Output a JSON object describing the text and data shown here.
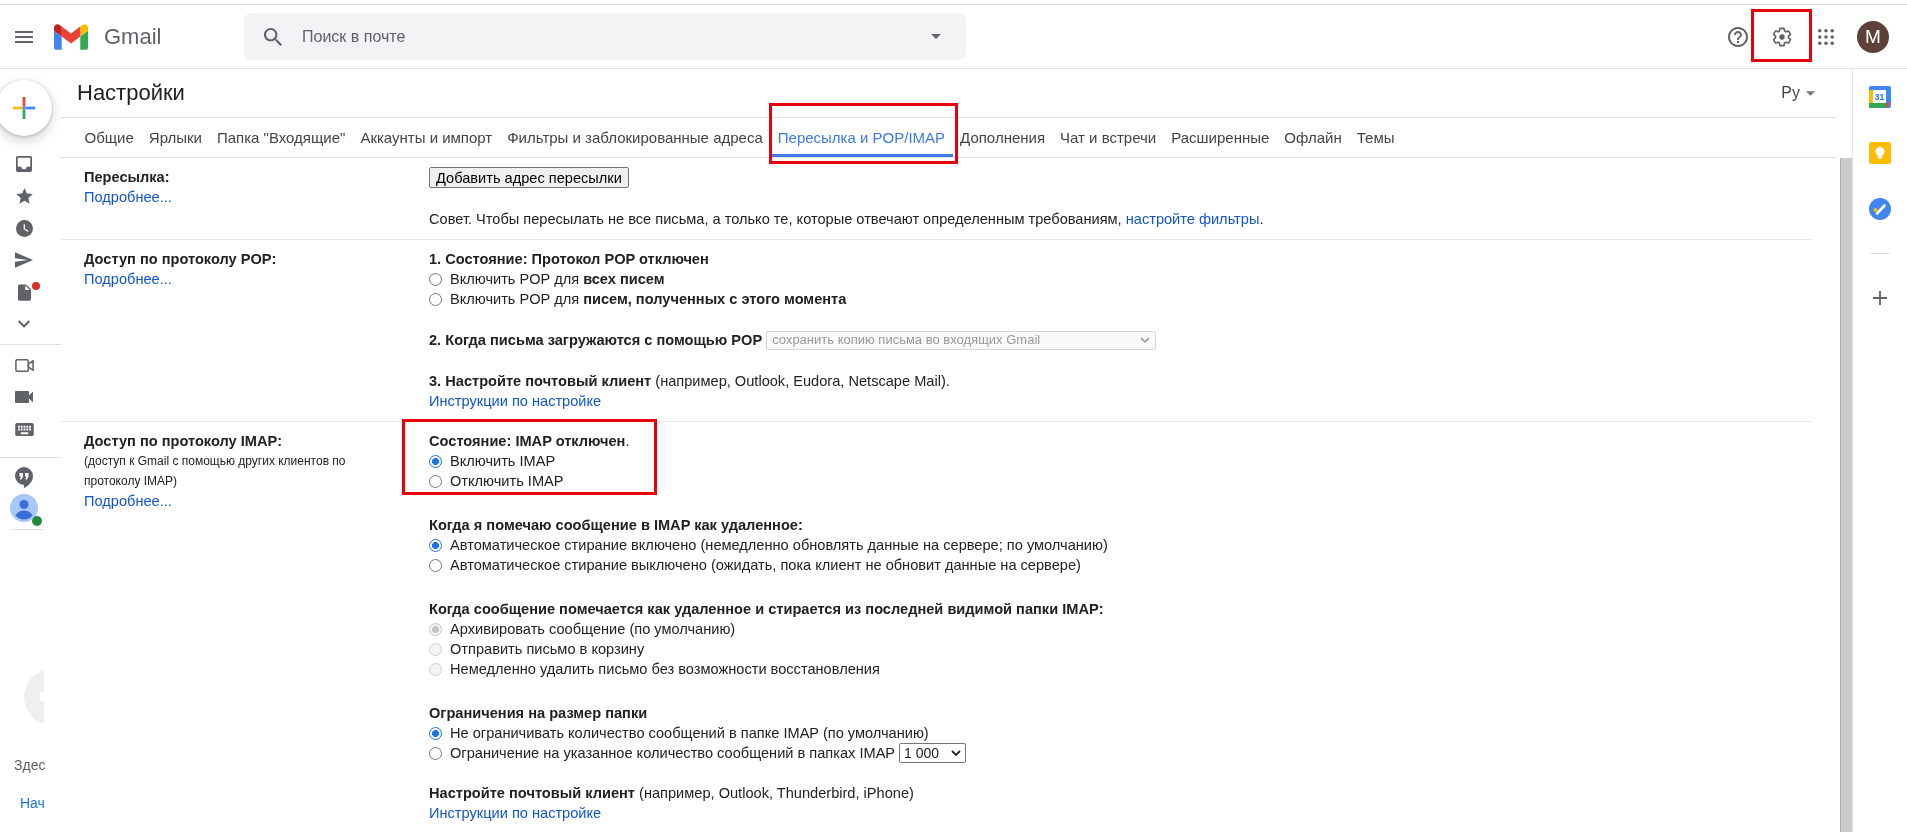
{
  "header": {
    "product_name": "Gmail",
    "search": {
      "placeholder": "Поиск в почте"
    },
    "settings_highlighted": true,
    "avatar_letter": "M"
  },
  "sidebar": {
    "draft_notification": true,
    "status_online": true,
    "panel_texts": [
      {
        "text": "Здес",
        "kind": "text"
      },
      {
        "text": "Нач",
        "kind": "link"
      }
    ]
  },
  "settings": {
    "title": "Настройки",
    "language": "Ру"
  },
  "tabs": [
    {
      "label": "Общие",
      "selected": false,
      "highlighted": false
    },
    {
      "label": "Ярлыки",
      "selected": false,
      "highlighted": false
    },
    {
      "label": "Папка \"Входящие\"",
      "selected": false,
      "highlighted": false
    },
    {
      "label": "Аккаунты и импорт",
      "selected": false,
      "highlighted": false
    },
    {
      "label": "Фильтры и заблокированные адреса",
      "selected": false,
      "highlighted": false
    },
    {
      "label": "Пересылка и POP/IMAP",
      "selected": true,
      "highlighted": true
    },
    {
      "label": "Дополнения",
      "selected": false,
      "highlighted": false
    },
    {
      "label": "Чат и встречи",
      "selected": false,
      "highlighted": false
    },
    {
      "label": "Расширенные",
      "selected": false,
      "highlighted": false
    },
    {
      "label": "Офлайн",
      "selected": false,
      "highlighted": false
    },
    {
      "label": "Темы",
      "selected": false,
      "highlighted": false
    }
  ],
  "sections": [
    {
      "label": "Пересылка:",
      "more_link": "Подробнее...",
      "blocks": [
        {
          "kind": "button",
          "label": "Добавить адрес пересылки"
        },
        {
          "kind": "tip",
          "text": "Совет. Чтобы пересылать не все письма, а только те, которые отвечают определенным требованиям,",
          "link": "настройте фильтры",
          "end": "."
        }
      ]
    },
    {
      "label": "Доступ по протоколу POP:",
      "more_link": "Подробнее...",
      "blocks": [
        {
          "kind": "radio_group",
          "title": "1. Состояние: Протокол POP отключен",
          "disabled": false,
          "options": [
            {
              "label": "Включить POP для **всех писем**",
              "selected": false
            },
            {
              "label": "Включить POP для **писем, полученных с этого момента**",
              "selected": false
            }
          ]
        },
        {
          "kind": "select_line",
          "title": "2. Когда письма загружаются с помощью POP",
          "value": "сохранить копию письма во входящих Gmail",
          "disabled": true
        },
        {
          "kind": "link_line",
          "caption": "**3. Настройте почтовый клиент** (например, Outlook, Eudora, Netscape Mail).",
          "link": "Инструкции по настройке"
        }
      ]
    },
    {
      "label": "Доступ по протоколу IMAP:",
      "description": "(доступ к Gmail с помощью других клиентов по протоколу IMAP)",
      "more_link": "Подробнее...",
      "blocks": [
        {
          "kind": "radio_group",
          "caption": "**Состояние: IMAP отключен**.",
          "disabled": false,
          "highlighted": true,
          "options": [
            {
              "label": "Включить IMAP",
              "selected": true
            },
            {
              "label": "Отключить IMAP",
              "selected": false
            }
          ]
        },
        {
          "kind": "radio_group",
          "title": "Когда я помечаю сообщение в IMAP как удаленное:",
          "disabled": false,
          "options": [
            {
              "label": "Автоматическое стирание включено (немедленно обновлять данные на сервере; по умолчанию)",
              "selected": true
            },
            {
              "label": "Автоматическое стирание выключено (ожидать, пока клиент не обновит данные на сервере)",
              "selected": false
            }
          ]
        },
        {
          "kind": "radio_group",
          "title": "Когда сообщение помечается как удаленное и стирается из последней видимой папки IMAP:",
          "disabled": true,
          "options": [
            {
              "label": "Архивировать сообщение (по умолчанию)",
              "selected": true
            },
            {
              "label": "Отправить письмо в корзину",
              "selected": false
            },
            {
              "label": "Немедленно удалить письмо без возможности восстановления",
              "selected": false
            }
          ]
        },
        {
          "kind": "radio_group",
          "title": "Ограничения на размер папки",
          "disabled": false,
          "options": [
            {
              "label": "Не ограничивать количество сообщений в папке IMAP (по умолчанию)",
              "selected": true
            },
            {
              "label": "Ограничение на указанное количество сообщений в папках IMAP",
              "selected": false,
              "select": "1 000"
            }
          ]
        },
        {
          "kind": "link_line",
          "caption": "**Настройте почтовый клиент** (например, Outlook, Thunderbird, iPhone)",
          "link": "Инструкции по настройке"
        }
      ]
    }
  ],
  "right_panel": {
    "calendar_day": "31"
  }
}
